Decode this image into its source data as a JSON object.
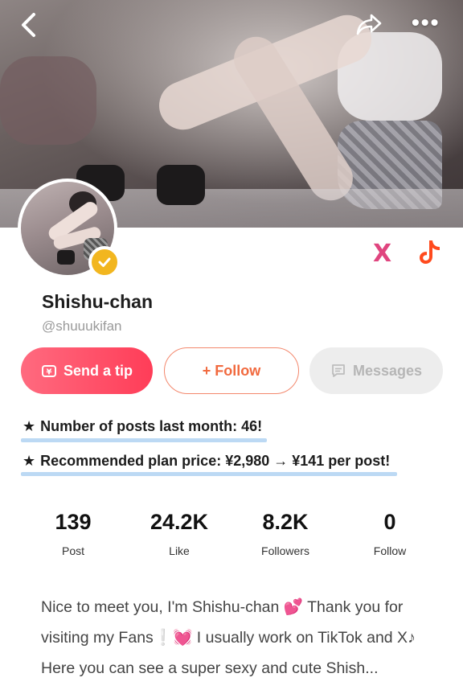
{
  "profile": {
    "display_name": "Shishu-chan",
    "handle": "@shuuukifan"
  },
  "topbar": {
    "more_label": "•••"
  },
  "social": {
    "x_label": "X"
  },
  "actions": {
    "tip_label": "Send a tip",
    "follow_label": "+ Follow",
    "messages_label": "Messages"
  },
  "notes": [
    {
      "star": "★",
      "text": "Number of posts last month: 46!"
    },
    {
      "star": "★",
      "text": "Recommended plan price: ¥2,980 → ¥141 per post!"
    }
  ],
  "stats": [
    {
      "value": "139",
      "label": "Post"
    },
    {
      "value": "24.2K",
      "label": "Like"
    },
    {
      "value": "8.2K",
      "label": "Followers"
    },
    {
      "value": "0",
      "label": "Follow"
    }
  ],
  "bio": {
    "part1": "Nice to meet you, I'm Shishu-chan ",
    "emoji1": "💕",
    "part2": " Thank you for visiting my Fans",
    "emoji2": "❕",
    "emoji3": "💓",
    "part3": " I usually work on TikTok and X",
    "emoji4": "♪",
    "part4": " Here you can see a super sexy and cute Shish..."
  },
  "colors": {
    "accent_pink": "#ff4560",
    "follow_orange": "#f16a3f",
    "badge_gold": "#f2b61f",
    "underline_blue": "#bcd9f4"
  }
}
